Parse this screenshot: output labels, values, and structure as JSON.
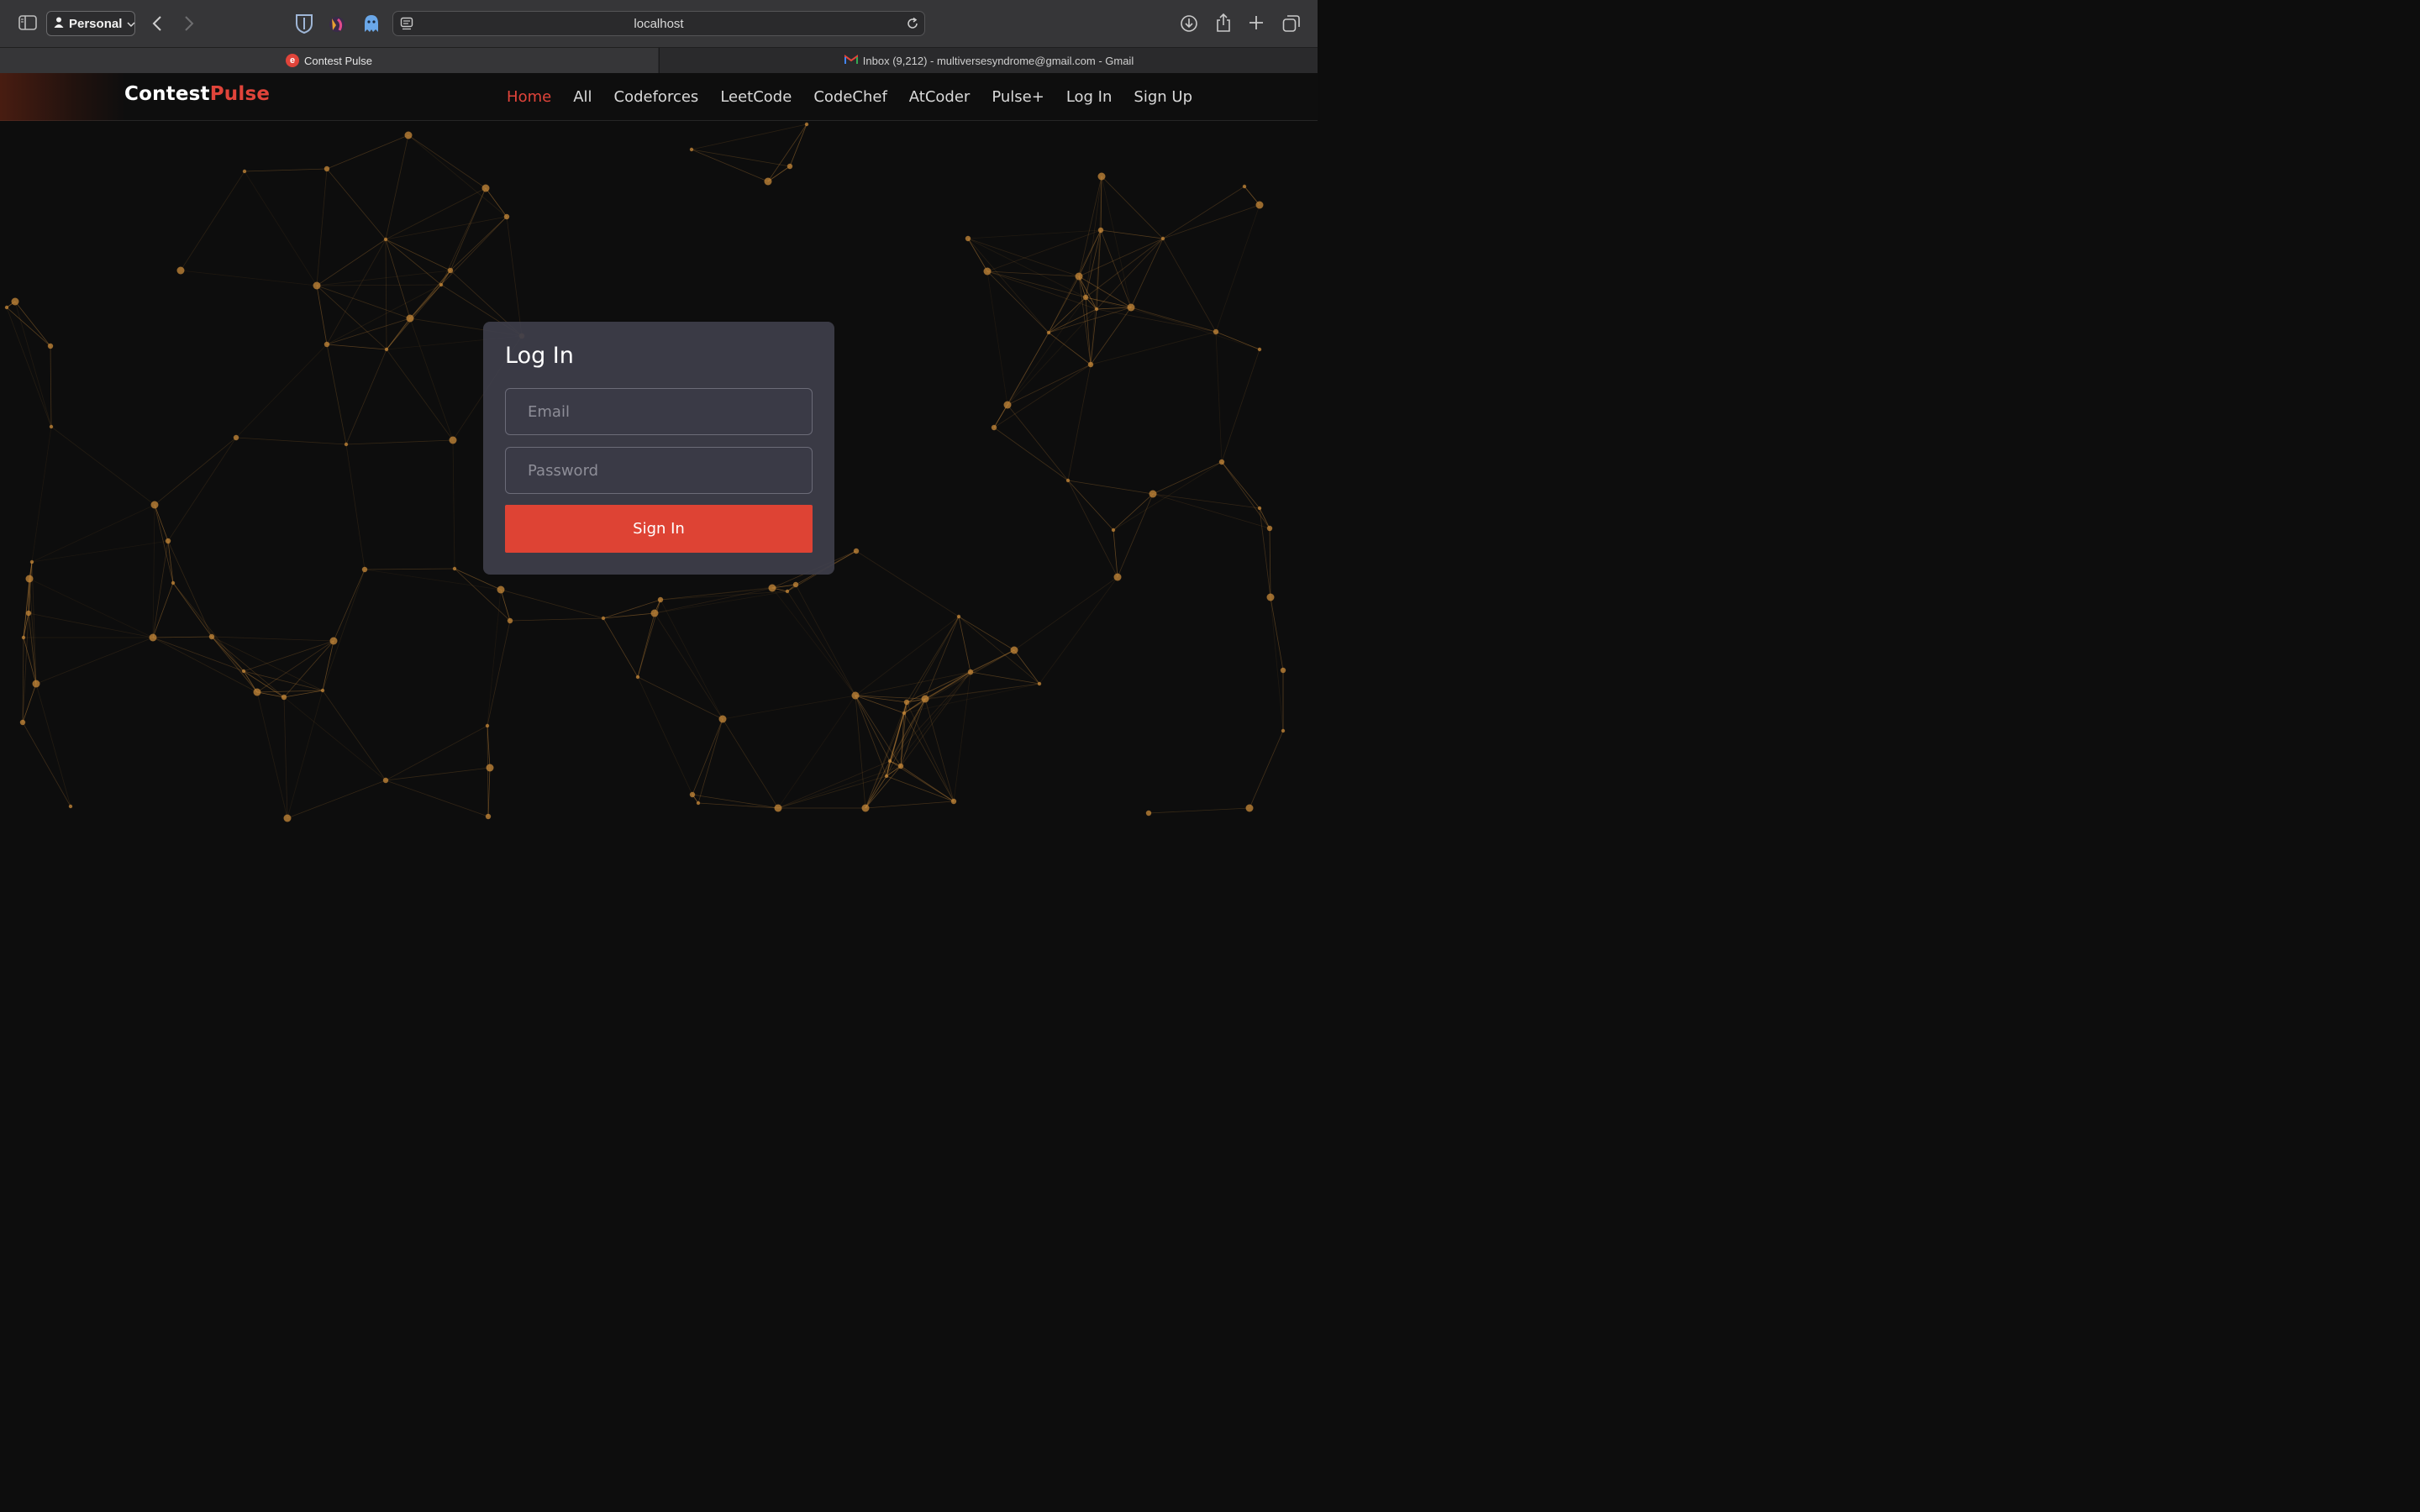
{
  "browser": {
    "profile_label": "Personal",
    "address": "localhost",
    "tabs": [
      {
        "label": "Contest Pulse",
        "favicon": "e"
      },
      {
        "label": "Inbox (9,212) - multiversesyndrome@gmail.com - Gmail"
      }
    ],
    "icons": [
      "sidebar-icon",
      "person-icon",
      "chevron-down-icon",
      "back-icon",
      "forward-icon",
      "bitwarden-icon",
      "extension-icon",
      "ghostery-icon",
      "reader-icon",
      "reload-icon",
      "downloads-icon",
      "share-icon",
      "new-tab-icon",
      "tab-overview-icon",
      "gmail-icon"
    ]
  },
  "site": {
    "brand_part1": "Contest",
    "brand_part2": "Pulse",
    "nav": [
      {
        "label": "Home",
        "active": true
      },
      {
        "label": "All"
      },
      {
        "label": "Codeforces"
      },
      {
        "label": "LeetCode"
      },
      {
        "label": "CodeChef"
      },
      {
        "label": "AtCoder"
      },
      {
        "label": "Pulse+"
      },
      {
        "label": "Log In"
      },
      {
        "label": "Sign Up"
      }
    ]
  },
  "login": {
    "title": "Log In",
    "email_placeholder": "Email",
    "password_placeholder": "Password",
    "submit_label": "Sign In"
  },
  "colors": {
    "accent": "#e0443a",
    "network": "#c8893a",
    "background": "#0d0d0d",
    "card": "#3e3e4a"
  }
}
